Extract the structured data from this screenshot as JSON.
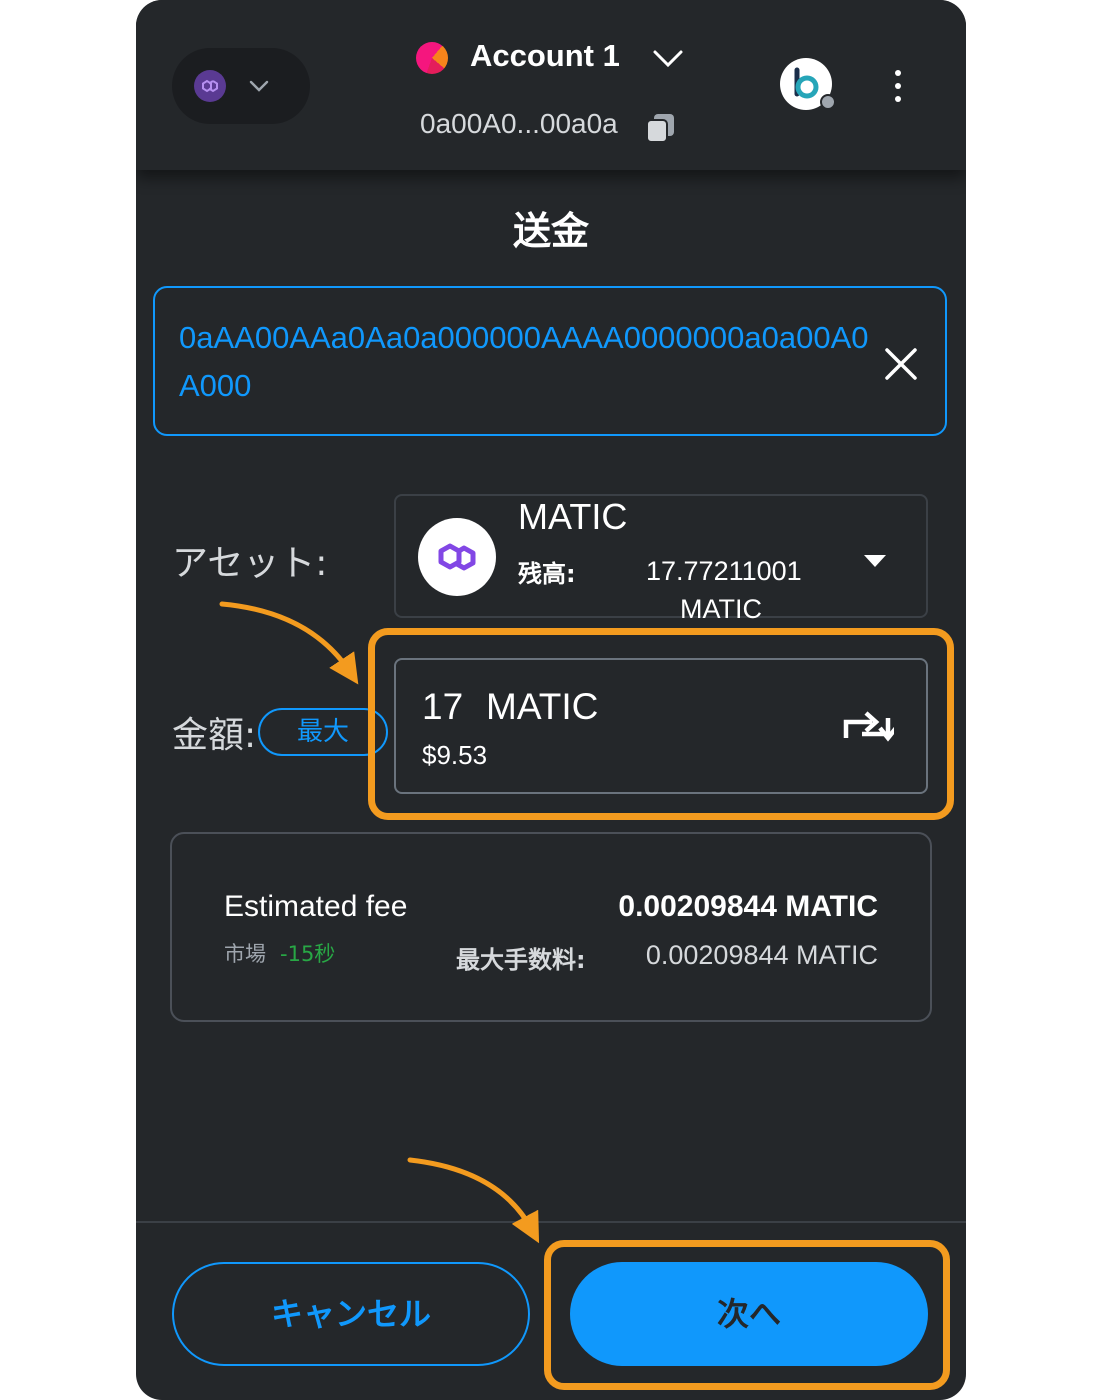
{
  "header": {
    "network_icon": "polygon-logo",
    "account_name": "Account 1",
    "account_address": "0a00A0...00a0a",
    "icons": [
      "chevron-down-icon",
      "copy-icon",
      "connected-site-icon",
      "kebab-menu-icon"
    ]
  },
  "page": {
    "title": "送金"
  },
  "recipient": {
    "address": "0aAA00AAa0Aa0a000000AAAA0000000a0a00A0A000"
  },
  "asset": {
    "label": "アセット:",
    "symbol": "MATIC",
    "balance_label": "残高:",
    "balance_value": "17.77211001 MATIC"
  },
  "amount": {
    "label": "金額:",
    "max_label": "最大",
    "value": "17",
    "symbol": "MATIC",
    "fiat": "$9.53"
  },
  "fee": {
    "label": "Estimated fee",
    "market": "市場",
    "time": "-15秒",
    "value": "0.00209844 MATIC",
    "max_label": "最大手数料:",
    "max_value": "0.00209844 MATIC"
  },
  "footer": {
    "cancel_label": "キャンセル",
    "next_label": "次へ"
  },
  "colors": {
    "background": "#24272a",
    "accent": "#1098fc",
    "highlight": "#f39b1f",
    "success": "#28a745"
  }
}
